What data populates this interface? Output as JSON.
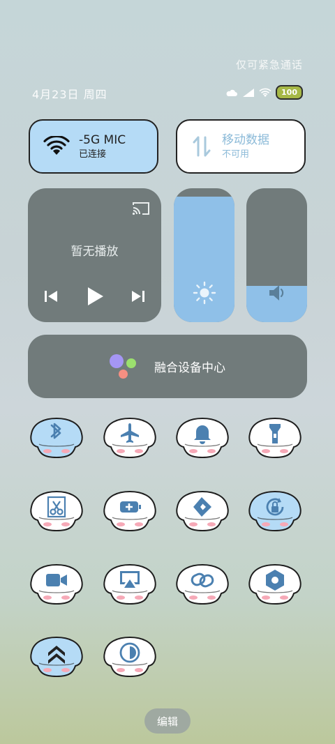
{
  "status": {
    "emergency_text": "仅可紧急通话",
    "date": "4月23日 周四",
    "battery": "100"
  },
  "wifi_card": {
    "title": "-5G     MIC",
    "subtitle": "已连接"
  },
  "mobile_card": {
    "title": "移动数据",
    "subtitle": "不可用"
  },
  "media": {
    "title": "暂无播放"
  },
  "brightness": {
    "level": 0.94
  },
  "volume": {
    "level": 0.27
  },
  "devices": {
    "label": "融合设备中心"
  },
  "tiles": [
    {
      "name": "bluetooth",
      "active": true
    },
    {
      "name": "airplane",
      "active": false
    },
    {
      "name": "bell",
      "active": false
    },
    {
      "name": "flashlight",
      "active": false
    },
    {
      "name": "screenshot",
      "active": false
    },
    {
      "name": "battery-saver",
      "active": false
    },
    {
      "name": "share",
      "active": false
    },
    {
      "name": "rotation-lock",
      "active": true
    },
    {
      "name": "screen-record",
      "active": false
    },
    {
      "name": "screen-cast",
      "active": false
    },
    {
      "name": "link",
      "active": false
    },
    {
      "name": "settings",
      "active": false
    },
    {
      "name": "up",
      "active": true
    },
    {
      "name": "dark-mode",
      "active": false
    }
  ],
  "edit": {
    "label": "编辑"
  },
  "colors": {
    "tile_active": "#b5dbf6",
    "tile_inactive": "#ffffff",
    "glyph": "#4b80b0",
    "slider_fill": "#8fc0e8",
    "panel": "#717b7b"
  }
}
